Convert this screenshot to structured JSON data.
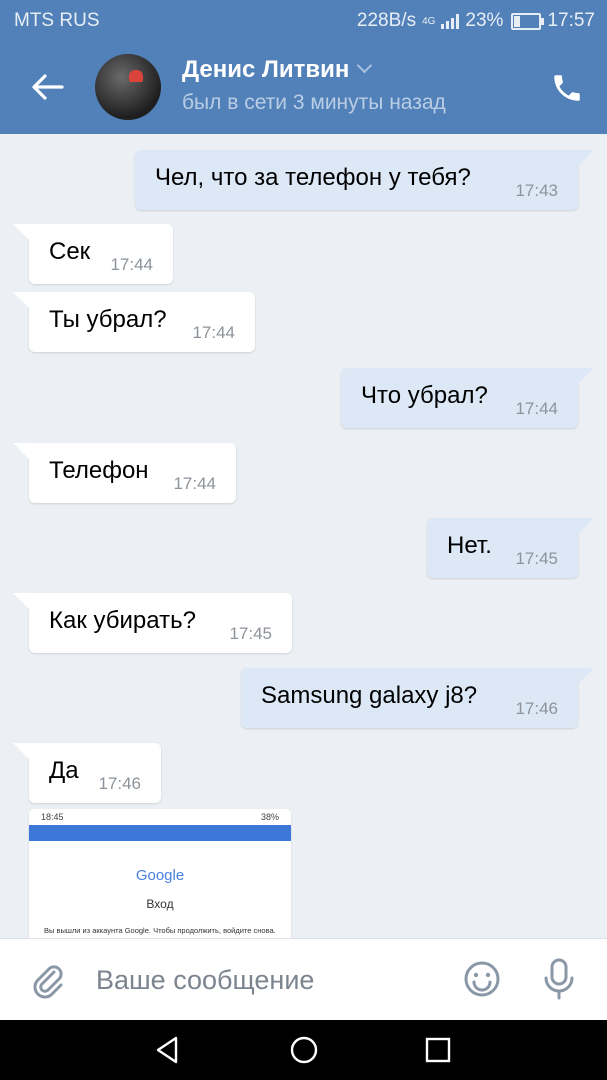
{
  "status_bar": {
    "carrier": "MTS RUS",
    "speed": "228B/s",
    "network": "4G",
    "battery": "23%",
    "battery_level": 0.23,
    "time": "17:57"
  },
  "header": {
    "contact_name": "Денис Литвин",
    "presence": "был в сети 3 минуты назад"
  },
  "messages": [
    {
      "side": "out",
      "text": "Чел, что за телефон у тебя?",
      "time": "17:43"
    },
    {
      "side": "in",
      "text": "Сек",
      "time": "17:44"
    },
    {
      "side": "in",
      "text": "Ты убрал?",
      "time": "17:44"
    },
    {
      "side": "out",
      "text": "Что убрал?",
      "time": "17:44"
    },
    {
      "side": "in",
      "text": "Телефон",
      "time": "17:44"
    },
    {
      "side": "out",
      "text": "Нет.",
      "time": "17:45"
    },
    {
      "side": "in",
      "text": "Как убирать?",
      "time": "17:45"
    },
    {
      "side": "out",
      "text": "Samsung galaxy j8?",
      "time": "17:46"
    },
    {
      "side": "in",
      "text": "Да",
      "time": "17:46"
    }
  ],
  "attachment": {
    "time": "18:45",
    "battery": "38%",
    "google": "Google",
    "title": "Вход",
    "note": "Вы вышли из аккаунта Google. Чтобы продолжить, войдите снова."
  },
  "composer": {
    "placeholder": "Ваше сообщение"
  },
  "colors": {
    "header": "#5181b8",
    "incoming_bubble": "#ffffff",
    "outgoing_bubble": "#dde8f6",
    "chat_background": "#ecf0f4"
  },
  "icons": [
    "back-arrow-icon",
    "phone-icon",
    "chevron-down-icon",
    "scroll-down-icon",
    "paperclip-icon",
    "smile-icon",
    "microphone-icon",
    "nav-back-icon",
    "nav-home-icon",
    "nav-recents-icon"
  ]
}
